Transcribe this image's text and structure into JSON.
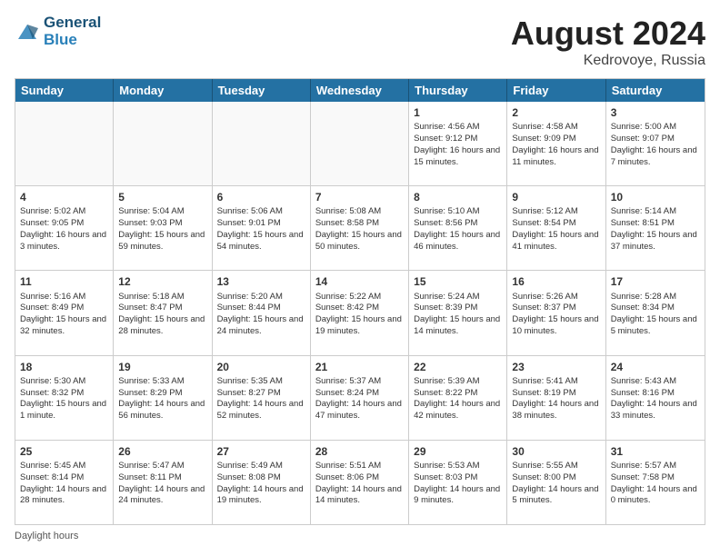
{
  "header": {
    "logo_line1": "General",
    "logo_line2": "Blue",
    "title": "August 2024",
    "location": "Kedrovoye, Russia"
  },
  "days_of_week": [
    "Sunday",
    "Monday",
    "Tuesday",
    "Wednesday",
    "Thursday",
    "Friday",
    "Saturday"
  ],
  "footer": {
    "daylight_label": "Daylight hours"
  },
  "weeks": [
    [
      {
        "day": "",
        "content": ""
      },
      {
        "day": "",
        "content": ""
      },
      {
        "day": "",
        "content": ""
      },
      {
        "day": "",
        "content": ""
      },
      {
        "day": "1",
        "content": "Sunrise: 4:56 AM\nSunset: 9:12 PM\nDaylight: 16 hours and 15 minutes."
      },
      {
        "day": "2",
        "content": "Sunrise: 4:58 AM\nSunset: 9:09 PM\nDaylight: 16 hours and 11 minutes."
      },
      {
        "day": "3",
        "content": "Sunrise: 5:00 AM\nSunset: 9:07 PM\nDaylight: 16 hours and 7 minutes."
      }
    ],
    [
      {
        "day": "4",
        "content": "Sunrise: 5:02 AM\nSunset: 9:05 PM\nDaylight: 16 hours and 3 minutes."
      },
      {
        "day": "5",
        "content": "Sunrise: 5:04 AM\nSunset: 9:03 PM\nDaylight: 15 hours and 59 minutes."
      },
      {
        "day": "6",
        "content": "Sunrise: 5:06 AM\nSunset: 9:01 PM\nDaylight: 15 hours and 54 minutes."
      },
      {
        "day": "7",
        "content": "Sunrise: 5:08 AM\nSunset: 8:58 PM\nDaylight: 15 hours and 50 minutes."
      },
      {
        "day": "8",
        "content": "Sunrise: 5:10 AM\nSunset: 8:56 PM\nDaylight: 15 hours and 46 minutes."
      },
      {
        "day": "9",
        "content": "Sunrise: 5:12 AM\nSunset: 8:54 PM\nDaylight: 15 hours and 41 minutes."
      },
      {
        "day": "10",
        "content": "Sunrise: 5:14 AM\nSunset: 8:51 PM\nDaylight: 15 hours and 37 minutes."
      }
    ],
    [
      {
        "day": "11",
        "content": "Sunrise: 5:16 AM\nSunset: 8:49 PM\nDaylight: 15 hours and 32 minutes."
      },
      {
        "day": "12",
        "content": "Sunrise: 5:18 AM\nSunset: 8:47 PM\nDaylight: 15 hours and 28 minutes."
      },
      {
        "day": "13",
        "content": "Sunrise: 5:20 AM\nSunset: 8:44 PM\nDaylight: 15 hours and 24 minutes."
      },
      {
        "day": "14",
        "content": "Sunrise: 5:22 AM\nSunset: 8:42 PM\nDaylight: 15 hours and 19 minutes."
      },
      {
        "day": "15",
        "content": "Sunrise: 5:24 AM\nSunset: 8:39 PM\nDaylight: 15 hours and 14 minutes."
      },
      {
        "day": "16",
        "content": "Sunrise: 5:26 AM\nSunset: 8:37 PM\nDaylight: 15 hours and 10 minutes."
      },
      {
        "day": "17",
        "content": "Sunrise: 5:28 AM\nSunset: 8:34 PM\nDaylight: 15 hours and 5 minutes."
      }
    ],
    [
      {
        "day": "18",
        "content": "Sunrise: 5:30 AM\nSunset: 8:32 PM\nDaylight: 15 hours and 1 minute."
      },
      {
        "day": "19",
        "content": "Sunrise: 5:33 AM\nSunset: 8:29 PM\nDaylight: 14 hours and 56 minutes."
      },
      {
        "day": "20",
        "content": "Sunrise: 5:35 AM\nSunset: 8:27 PM\nDaylight: 14 hours and 52 minutes."
      },
      {
        "day": "21",
        "content": "Sunrise: 5:37 AM\nSunset: 8:24 PM\nDaylight: 14 hours and 47 minutes."
      },
      {
        "day": "22",
        "content": "Sunrise: 5:39 AM\nSunset: 8:22 PM\nDaylight: 14 hours and 42 minutes."
      },
      {
        "day": "23",
        "content": "Sunrise: 5:41 AM\nSunset: 8:19 PM\nDaylight: 14 hours and 38 minutes."
      },
      {
        "day": "24",
        "content": "Sunrise: 5:43 AM\nSunset: 8:16 PM\nDaylight: 14 hours and 33 minutes."
      }
    ],
    [
      {
        "day": "25",
        "content": "Sunrise: 5:45 AM\nSunset: 8:14 PM\nDaylight: 14 hours and 28 minutes."
      },
      {
        "day": "26",
        "content": "Sunrise: 5:47 AM\nSunset: 8:11 PM\nDaylight: 14 hours and 24 minutes."
      },
      {
        "day": "27",
        "content": "Sunrise: 5:49 AM\nSunset: 8:08 PM\nDaylight: 14 hours and 19 minutes."
      },
      {
        "day": "28",
        "content": "Sunrise: 5:51 AM\nSunset: 8:06 PM\nDaylight: 14 hours and 14 minutes."
      },
      {
        "day": "29",
        "content": "Sunrise: 5:53 AM\nSunset: 8:03 PM\nDaylight: 14 hours and 9 minutes."
      },
      {
        "day": "30",
        "content": "Sunrise: 5:55 AM\nSunset: 8:00 PM\nDaylight: 14 hours and 5 minutes."
      },
      {
        "day": "31",
        "content": "Sunrise: 5:57 AM\nSunset: 7:58 PM\nDaylight: 14 hours and 0 minutes."
      }
    ]
  ]
}
